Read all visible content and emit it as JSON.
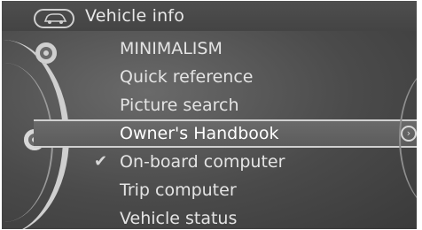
{
  "header": {
    "title": "Vehicle info",
    "icon": "car-icon"
  },
  "menu": {
    "items": [
      {
        "label": "MINIMALISM"
      },
      {
        "label": "Quick reference"
      },
      {
        "label": "Picture search"
      },
      {
        "label": "Owner's Handbook",
        "selected": true
      },
      {
        "label": "On-board computer",
        "checked": true
      },
      {
        "label": "Trip computer"
      },
      {
        "label": "Vehicle status"
      }
    ]
  },
  "colors": {
    "background": "#4a4a4a",
    "text": "#e8e8e8",
    "highlight": "#d0d0d0"
  }
}
